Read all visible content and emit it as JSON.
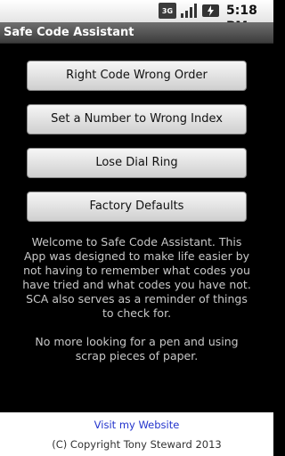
{
  "status_bar": {
    "network_label": "3G",
    "time": "5:18 PM"
  },
  "app": {
    "title": "Safe Code Assistant"
  },
  "buttons": {
    "right_code_wrong_order": "Right Code Wrong Order",
    "set_number_wrong_index": "Set a Number to Wrong Index",
    "lose_dial_ring": "Lose Dial Ring",
    "factory_defaults": "Factory Defaults"
  },
  "welcome": {
    "paragraph1": "Welcome to Safe Code Assistant. This App was designed to make life easier by not having to remember what codes you have tried and what codes you have not. SCA also serves as a reminder of things to check for.",
    "paragraph2": "No more looking for a pen and using scrap pieces of paper."
  },
  "footer": {
    "website_link": "Visit my Website",
    "copyright": "(C) Copyright Tony Steward 2013"
  },
  "colors": {
    "background": "#000000",
    "link": "#2233cc",
    "text": "#c8c8c8"
  }
}
